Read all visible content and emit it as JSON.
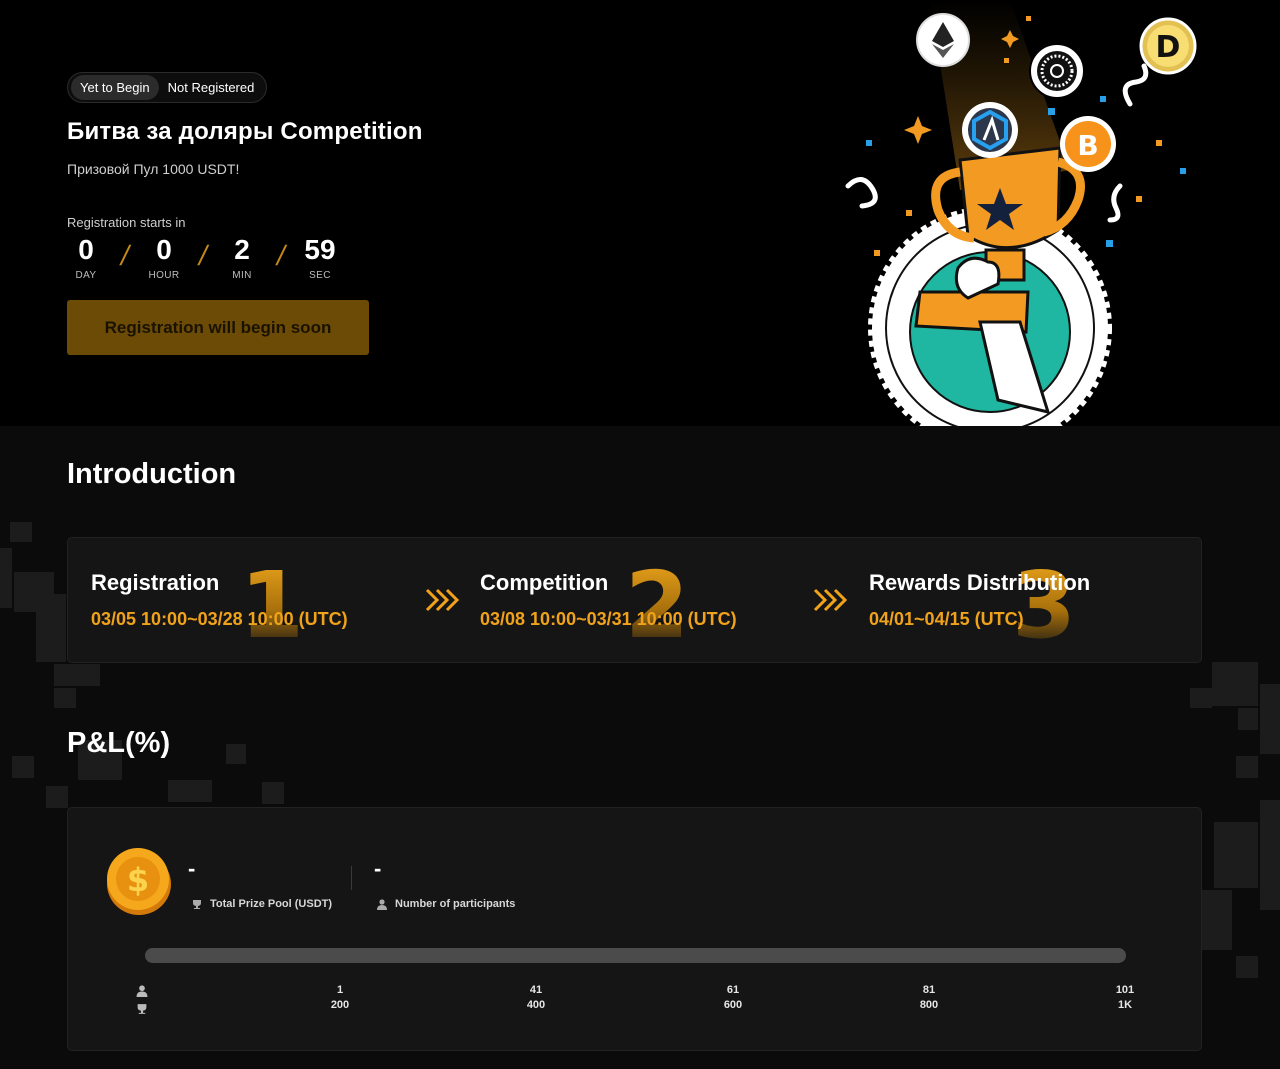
{
  "hero": {
    "status_tags": [
      "Yet to Begin",
      "Not Registered"
    ],
    "title": "Битва за доляры Competition",
    "subtitle": "Призовой Пул 1000 USDT!",
    "registration_label": "Registration starts in",
    "countdown": [
      {
        "value": "0",
        "unit": "DAY"
      },
      {
        "value": "0",
        "unit": "HOUR"
      },
      {
        "value": "2",
        "unit": "MIN"
      },
      {
        "value": "59",
        "unit": "SEC"
      }
    ],
    "button_label": "Registration will begin soon",
    "icons": [
      "ethereum-icon",
      "nexo-icon",
      "dogecoin-icon",
      "arbitrum-icon",
      "bitcoin-icon",
      "trophy-icon"
    ]
  },
  "introduction": {
    "title": "Introduction",
    "steps": [
      {
        "number": "1",
        "title": "Registration",
        "date": "03/05 10:00~03/28 10:00 (UTC)"
      },
      {
        "number": "2",
        "title": "Competition",
        "date": "03/08 10:00~03/31 10:00 (UTC)"
      },
      {
        "number": "3",
        "title": "Rewards Distribution",
        "date": "04/01~04/15 (UTC)"
      }
    ]
  },
  "pnl": {
    "title": "P&L(%)",
    "total_prize_pool": {
      "value": "-",
      "label": "Total Prize Pool (USDT)"
    },
    "participants": {
      "value": "-",
      "label": "Number of participants"
    },
    "progress": 0,
    "ticks": [
      {
        "participants": "1",
        "prize": "200"
      },
      {
        "participants": "41",
        "prize": "400"
      },
      {
        "participants": "61",
        "prize": "600"
      },
      {
        "participants": "81",
        "prize": "800"
      },
      {
        "participants": "101",
        "prize": "1K"
      }
    ]
  },
  "colors": {
    "accent": "#f0a21a",
    "button_bg": "#6b4b06",
    "card_bg": "#151515",
    "page_bg": "#0b0b0b"
  }
}
